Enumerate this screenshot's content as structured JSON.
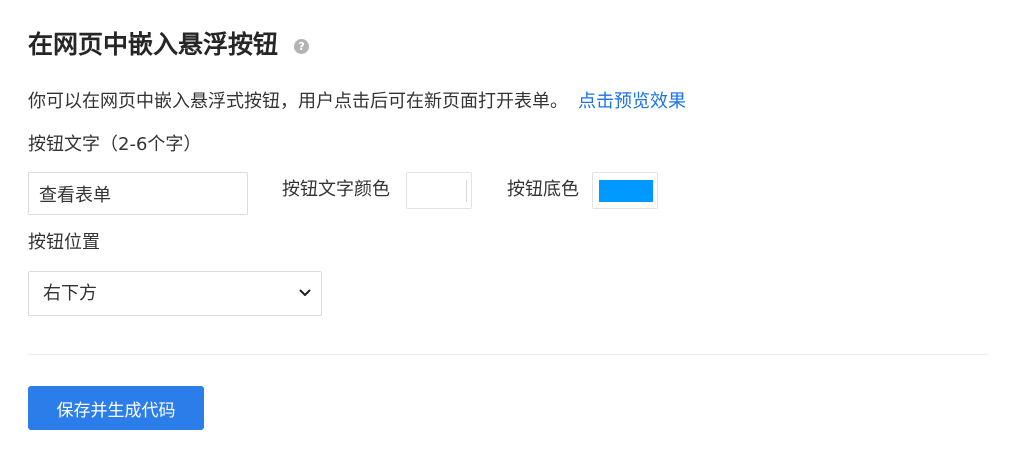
{
  "header": {
    "title": "在网页中嵌入悬浮按钮",
    "help_glyph": "?"
  },
  "description": {
    "text": "你可以在网页中嵌入悬浮式按钮，用户点击后可在新页面打开表单。",
    "link_label": "点击预览效果"
  },
  "form": {
    "button_text_label": "按钮文字（2-6个字）",
    "button_text_value": "查看表单",
    "text_color_label": "按钮文字颜色",
    "text_color_value": "#ffffff",
    "bg_color_label": "按钮底色",
    "bg_color_value": "#0099ff",
    "position_label": "按钮位置",
    "position_value": "右下方"
  },
  "actions": {
    "save_label": "保存并生成代码"
  },
  "colors": {
    "primary_button": "#2b7de9",
    "link": "#1a73e8"
  }
}
